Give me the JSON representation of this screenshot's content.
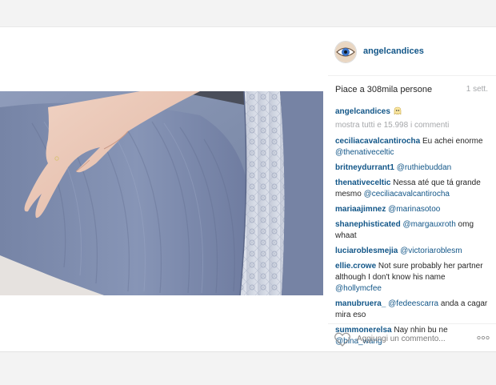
{
  "post": {
    "username": "angelcandices",
    "likes_text": "Piace a 308mila persone",
    "time_ago": "1 sett.",
    "caption_username": "angelcandices",
    "caption_emoji": "ghost-emoji",
    "show_all_comments": "mostra tutti e 15.998 i commenti"
  },
  "comments": [
    {
      "user": "ceciliacavalcantirocha",
      "text": " Eu achei enorme ",
      "mention": "@thenativeceltic",
      "after": ""
    },
    {
      "user": "britneydurrant1",
      "text": " ",
      "mention": "@ruthiebuddan",
      "after": ""
    },
    {
      "user": "thenativeceltic",
      "text": " Nessa até que tá grande mesmo ",
      "mention": "@ceciliacavalcantirocha",
      "after": ""
    },
    {
      "user": "mariaajimnez",
      "text": " ",
      "mention": "@marinasotoo",
      "after": ""
    },
    {
      "user": "shanephisticated",
      "text": " ",
      "mention": "@margauxroth",
      "after": " omg whaat"
    },
    {
      "user": "luciaroblesmejia",
      "text": " ",
      "mention": "@victoriaroblesm",
      "after": ""
    },
    {
      "user": "ellie.crowe",
      "text": " Not sure probably her partner although I don't know his name ",
      "mention": "@hollymcfee",
      "after": ""
    },
    {
      "user": "manubruera_",
      "text": " ",
      "mention": "@fedeescarra",
      "after": " anda a cagar mira eso"
    },
    {
      "user": "summonerelsa",
      "text": " Nay nhin bu ne ",
      "mention": "@bina_wang",
      "after": ""
    }
  ],
  "footer": {
    "comment_placeholder": "Aggiungi un commento...",
    "like_icon": "heart-icon",
    "more_icon": "more-options-icon"
  },
  "colors": {
    "link": "#125688",
    "muted": "#a5a7aa",
    "dress": "#7d8aa9"
  }
}
